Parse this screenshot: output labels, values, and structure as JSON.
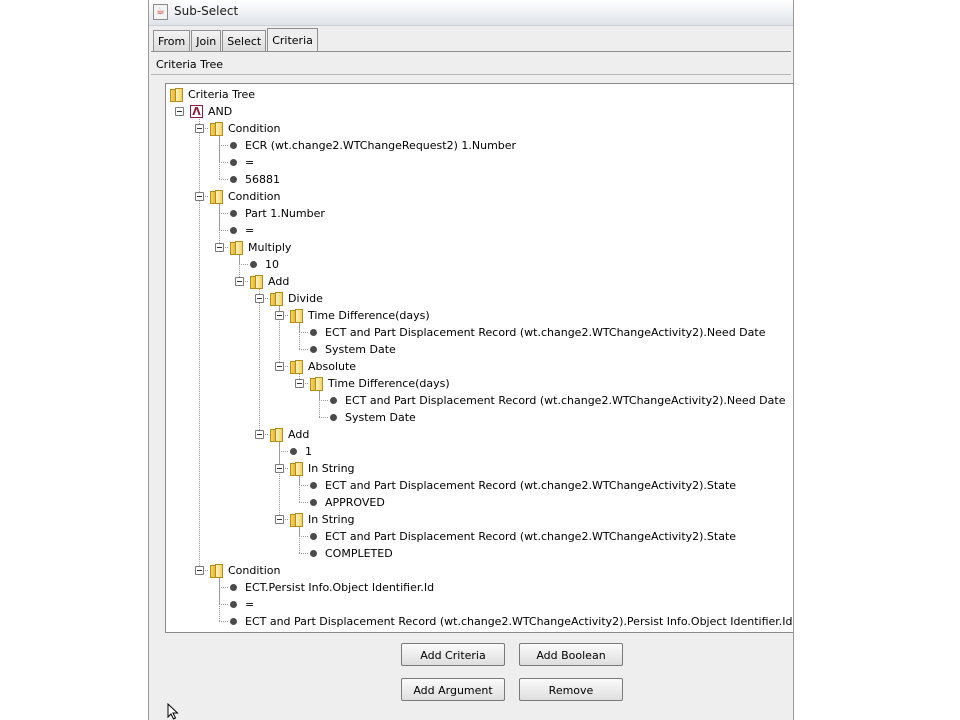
{
  "window": {
    "title": "Sub-Select",
    "app_icon": "java-cup-icon"
  },
  "tabs": [
    {
      "label": "From",
      "active": false
    },
    {
      "label": "Join",
      "active": false
    },
    {
      "label": "Select",
      "active": false
    },
    {
      "label": "Criteria",
      "active": true
    }
  ],
  "panel": {
    "title": "Criteria Tree"
  },
  "tree": [
    {
      "id": "n0",
      "depth": 0,
      "icon": "folder",
      "label": "Criteria Tree"
    },
    {
      "id": "n1",
      "depth": 1,
      "icon": "and",
      "label": "AND",
      "expanded": true
    },
    {
      "id": "n2",
      "depth": 2,
      "icon": "folder",
      "label": "Condition",
      "expanded": true
    },
    {
      "id": "n3",
      "depth": 3,
      "icon": "dot",
      "label": "ECR (wt.change2.WTChangeRequest2) 1.Number"
    },
    {
      "id": "n4",
      "depth": 3,
      "icon": "dot",
      "label": "="
    },
    {
      "id": "n5",
      "depth": 3,
      "icon": "dot",
      "label": "56881"
    },
    {
      "id": "n6",
      "depth": 2,
      "icon": "folder",
      "label": "Condition",
      "expanded": true
    },
    {
      "id": "n7",
      "depth": 3,
      "icon": "dot",
      "label": "Part 1.Number"
    },
    {
      "id": "n8",
      "depth": 3,
      "icon": "dot",
      "label": "="
    },
    {
      "id": "n9",
      "depth": 3,
      "icon": "folder",
      "label": "Multiply",
      "expanded": true
    },
    {
      "id": "n10",
      "depth": 4,
      "icon": "dot",
      "label": "10"
    },
    {
      "id": "n11",
      "depth": 4,
      "icon": "folder",
      "label": "Add",
      "expanded": true
    },
    {
      "id": "n12",
      "depth": 5,
      "icon": "folder",
      "label": "Divide",
      "expanded": true
    },
    {
      "id": "n13",
      "depth": 6,
      "icon": "folder",
      "label": "Time Difference(days)",
      "expanded": true
    },
    {
      "id": "n14",
      "depth": 7,
      "icon": "dot",
      "label": "ECT and Part Displacement Record (wt.change2.WTChangeActivity2).Need Date"
    },
    {
      "id": "n15",
      "depth": 7,
      "icon": "dot",
      "label": "System Date"
    },
    {
      "id": "n16",
      "depth": 6,
      "icon": "folder",
      "label": "Absolute",
      "expanded": true
    },
    {
      "id": "n17",
      "depth": 7,
      "icon": "folder",
      "label": "Time Difference(days)",
      "expanded": true
    },
    {
      "id": "n18",
      "depth": 8,
      "icon": "dot",
      "label": "ECT and Part Displacement Record (wt.change2.WTChangeActivity2).Need Date"
    },
    {
      "id": "n19",
      "depth": 8,
      "icon": "dot",
      "label": "System Date"
    },
    {
      "id": "n20",
      "depth": 5,
      "icon": "folder",
      "label": "Add",
      "expanded": true
    },
    {
      "id": "n21",
      "depth": 6,
      "icon": "dot",
      "label": "1"
    },
    {
      "id": "n22",
      "depth": 6,
      "icon": "folder",
      "label": "In String",
      "expanded": true
    },
    {
      "id": "n23",
      "depth": 7,
      "icon": "dot",
      "label": "ECT and Part Displacement Record (wt.change2.WTChangeActivity2).State"
    },
    {
      "id": "n24",
      "depth": 7,
      "icon": "dot",
      "label": "APPROVED"
    },
    {
      "id": "n25",
      "depth": 6,
      "icon": "folder",
      "label": "In String",
      "expanded": true
    },
    {
      "id": "n26",
      "depth": 7,
      "icon": "dot",
      "label": "ECT and Part Displacement Record (wt.change2.WTChangeActivity2).State"
    },
    {
      "id": "n27",
      "depth": 7,
      "icon": "dot",
      "label": "COMPLETED"
    },
    {
      "id": "n28",
      "depth": 2,
      "icon": "folder",
      "label": "Condition",
      "expanded": true
    },
    {
      "id": "n29",
      "depth": 3,
      "icon": "dot",
      "label": "ECT.Persist Info.Object Identifier.Id"
    },
    {
      "id": "n30",
      "depth": 3,
      "icon": "dot",
      "label": "="
    },
    {
      "id": "n31",
      "depth": 3,
      "icon": "dot",
      "label": "ECT and Part Displacement Record (wt.change2.WTChangeActivity2).Persist Info.Object Identifier.Id"
    }
  ],
  "buttons": {
    "add_criteria": "Add Criteria",
    "add_boolean": "Add Boolean",
    "add_argument": "Add Argument",
    "remove": "Remove"
  },
  "colors": {
    "and_icon": "#8a1e3a",
    "folder": "#f3d36a",
    "window_bg": "#eeeeee"
  }
}
